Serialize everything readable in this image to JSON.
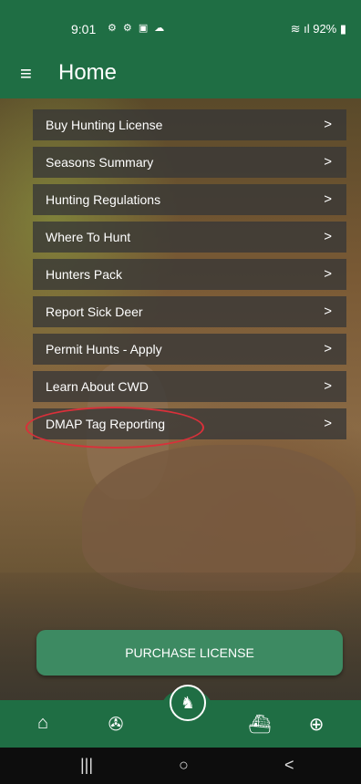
{
  "status": {
    "time": "9:01",
    "left_icons": "⚙ ⚙ ▣ ☁",
    "right_icons": "≋ ıl 92% ▮"
  },
  "app_bar": {
    "menu_icon": "≡",
    "title": "Home"
  },
  "menu": {
    "items": [
      {
        "label": "Buy Hunting License"
      },
      {
        "label": "Seasons Summary"
      },
      {
        "label": "Hunting Regulations"
      },
      {
        "label": "Where To Hunt"
      },
      {
        "label": "Hunters Pack"
      },
      {
        "label": "Report Sick Deer"
      },
      {
        "label": "Permit Hunts - Apply"
      },
      {
        "label": "Learn About CWD"
      },
      {
        "label": "DMAP Tag Reporting"
      }
    ],
    "chevron": ">",
    "highlight_color": "#d9303a"
  },
  "purchase_button": {
    "label": "PURCHASE LICENSE"
  },
  "bottom_nav": {
    "items": [
      {
        "icon": "home-icon",
        "glyph": "⌂"
      },
      {
        "icon": "fish-icon",
        "glyph": "✇"
      },
      {
        "icon": "deer-icon",
        "glyph": "♞"
      },
      {
        "icon": "boat-icon",
        "glyph": "⛴"
      },
      {
        "icon": "target-icon",
        "glyph": "⊕"
      }
    ]
  },
  "system_nav": {
    "recents": "|||",
    "home": "○",
    "back": "<"
  },
  "colors": {
    "brand_green": "#1f6e44",
    "button_green": "#3d8a62"
  }
}
